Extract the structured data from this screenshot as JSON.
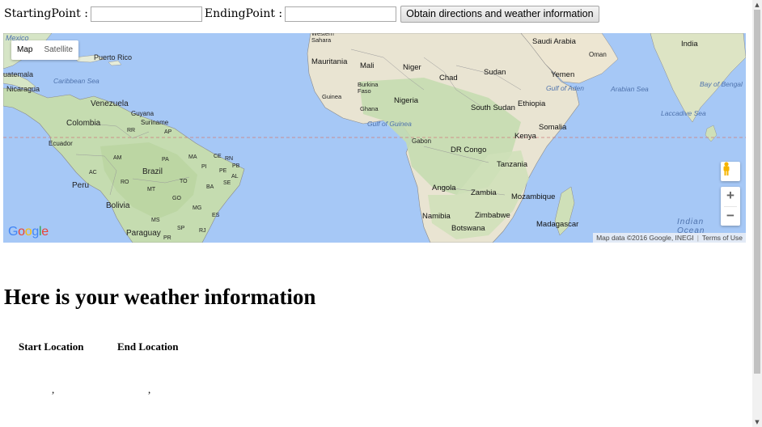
{
  "form": {
    "starting_label": "StartingPoint :",
    "starting_value": "",
    "ending_label": "EndingPoint :",
    "ending_value": "",
    "submit_label": "Obtain directions and weather information"
  },
  "map": {
    "map_type_options": [
      "Map",
      "Satellite"
    ],
    "selected_map_type": "Map",
    "attribution": "Map data ©2016 Google, INEGI",
    "terms": "Terms of Use",
    "zoom_in": "+",
    "zoom_out": "−",
    "logo_text": "Google",
    "labels": {
      "mexico": "Mexico",
      "puerto_rico": "Puerto Rico",
      "guatemala": "uatemala",
      "caribbean": "Caribbean Sea",
      "nicaragua": "Nicaragua",
      "venezuela": "Venezuela",
      "guyana": "Guyana",
      "suriname": "Suriname",
      "colombia": "Colombia",
      "rr": "RR",
      "ap": "AP",
      "ecuador": "Ecuador",
      "am": "AM",
      "pa": "PA",
      "ma": "MA",
      "ce": "CE",
      "rn": "RN",
      "pi": "PI",
      "pb": "PB",
      "pe_st": "PE",
      "al": "AL",
      "se": "SE",
      "ac": "AC",
      "brazil": "Brazil",
      "ro": "RO",
      "to": "TO",
      "ba": "BA",
      "peru": "Peru",
      "mt": "MT",
      "go": "GO",
      "bolivia": "Bolivia",
      "mg": "MG",
      "es": "ES",
      "ms": "MS",
      "sp": "SP",
      "rj": "RJ",
      "paraguay": "Paraguay",
      "pr": "PR",
      "western_sahara": "Western Sahara",
      "mauritania": "Mauritania",
      "mali": "Mali",
      "niger": "Niger",
      "chad": "Chad",
      "sudan": "Sudan",
      "saudi_arabia": "Saudi Arabia",
      "oman": "Oman",
      "india": "India",
      "burkina": "Burkina Faso",
      "guinea": "Guinea",
      "ghana": "Ghana",
      "nigeria": "Nigeria",
      "yemen": "Yemen",
      "gulf_aden": "Gulf of Aden",
      "arabian_sea": "Arabian Sea",
      "bay_bengal": "Bay of Bengal",
      "south_sudan": "South Sudan",
      "ethiopia": "Ethiopia",
      "laccadive": "Laccadive Sea",
      "gulf_guinea": "Gulf of Guinea",
      "somalia": "Somalia",
      "gabon": "Gabon",
      "kenya": "Kenya",
      "dr_congo": "DR Congo",
      "tanzania": "Tanzania",
      "angola": "Angola",
      "zambia": "Zambia",
      "mozambique": "Mozambique",
      "namibia": "Namibia",
      "zimbabwe": "Zimbabwe",
      "madagascar": "Madagascar",
      "botswana": "Botswana",
      "indian_ocean": "Indian Ocean"
    }
  },
  "weather": {
    "heading": "Here is your weather information",
    "start_header": "Start Location",
    "end_header": "End Location",
    "start_value": ",",
    "end_value": ","
  }
}
